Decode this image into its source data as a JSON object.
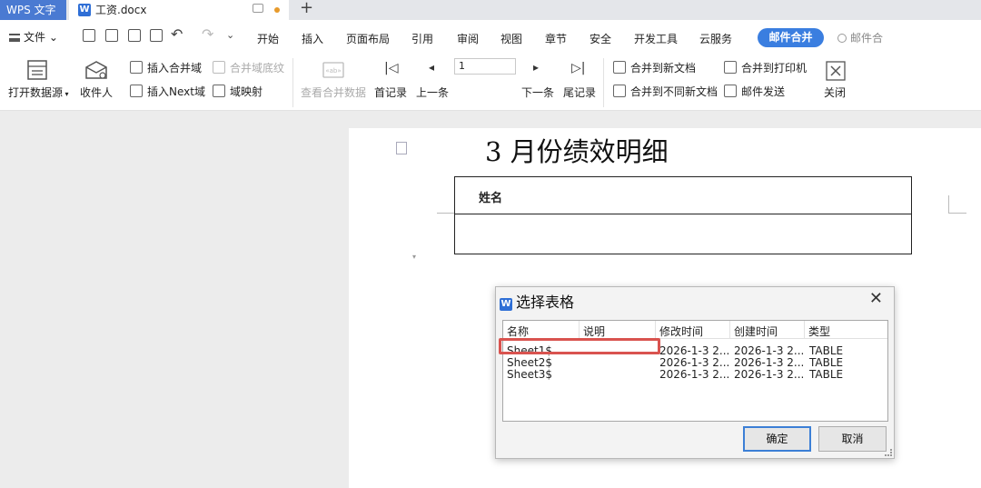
{
  "titlebar": {
    "app_tab": "WPS 文字",
    "doc_tab": "工资.docx",
    "new_tab": "+"
  },
  "menubar": {
    "file": "文件",
    "tabs": [
      "开始",
      "插入",
      "页面布局",
      "引用",
      "审阅",
      "视图",
      "章节",
      "安全",
      "开发工具",
      "云服务"
    ],
    "active_tab": "邮件合并",
    "search_placeholder": "邮件合"
  },
  "ribbon": {
    "open_datasource": "打开数据源",
    "recipients": "收件人",
    "insert_merge_field": "插入合并域",
    "merge_field_shading": "合并域底纹",
    "insert_next_field": "插入Next域",
    "field_mapping": "域映射",
    "view_merged_data": "查看合并数据",
    "first_record": "首记录",
    "prev_record": "上一条",
    "record_value": "1",
    "next_record": "下一条",
    "last_record": "尾记录",
    "merge_to_new_doc": "合并到新文档",
    "merge_to_separate_docs": "合并到不同新文档",
    "merge_to_printer": "合并到打印机",
    "mail_send": "邮件发送",
    "close": "关闭"
  },
  "document": {
    "title": "3 月份绩效明细",
    "table_cell": "姓名"
  },
  "dialog": {
    "title": "选择表格",
    "columns": [
      "名称",
      "说明",
      "修改时间",
      "创建时间",
      "类型"
    ],
    "rows": [
      {
        "name": "Sheet1$",
        "desc": "",
        "modified": "2026-1-3 2...",
        "created": "2026-1-3 2...",
        "type": "TABLE"
      },
      {
        "name": "Sheet2$",
        "desc": "",
        "modified": "2026-1-3 2...",
        "created": "2026-1-3 2...",
        "type": "TABLE"
      },
      {
        "name": "Sheet3$",
        "desc": "",
        "modified": "2026-1-3 2...",
        "created": "2026-1-3 2...",
        "type": "TABLE"
      }
    ],
    "ok": "确定",
    "cancel": "取消"
  },
  "colors": {
    "accent": "#3a7ee0",
    "app_tab_bg": "#4a7ad2",
    "highlight": "#d9534f"
  }
}
